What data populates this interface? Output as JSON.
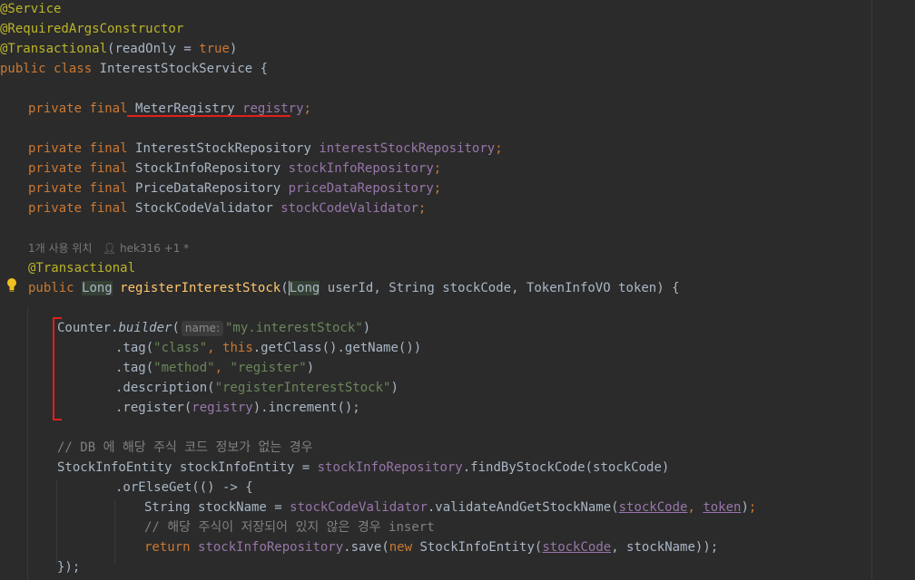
{
  "editor": {
    "lines": {
      "service": "@Service",
      "required_args": "@RequiredArgsConstructor",
      "transactional_ann": "@Transactional",
      "read_only": "readOnly",
      "equals": " = ",
      "true": "true",
      "public": "public",
      "class": "class",
      "class_name": "InterestStockService",
      "private": "private",
      "final": "final",
      "meter_type": "MeterRegistry",
      "meter_field": "registry",
      "repo_type": "InterestStockRepository",
      "repo_field": "interestStockRepository",
      "stockinfo_type": "StockInfoRepository",
      "stockinfo_field": "stockInfoRepository",
      "price_type": "PriceDataRepository",
      "price_field": "priceDataRepository",
      "validator_type": "StockCodeValidator",
      "validator_field": "stockCodeValidator",
      "usage_hint": "1개 사용 위치",
      "author_hint": "hek316 +1 *",
      "method_ann": "@Transactional",
      "long": "Long",
      "method_name": "registerInterestStock",
      "user_id": " userId, ",
      "string": "String",
      "stock_code_param": " stockCode, ",
      "token_type": "TokenInfoVO",
      "token_param": " token) {",
      "counter": "Counter",
      "builder": "builder",
      "name_hint": "name:",
      "counter_name": "\"my.interestStock\"",
      "tag": ".tag(",
      "class_str": "\"class\"",
      "this": "this",
      "get_class": ".getClass().getName())",
      "method_str": "\"method\"",
      "register_str": "\"register\"",
      "description": ".description(",
      "desc_str": "\"registerInterestStock\"",
      "register_call": ".register(",
      "increment": ").increment();",
      "comment1": "// DB 에 해당 주식 코드 정보가 없는 경우",
      "entity_type": "StockInfoEntity",
      "entity_var": " stockInfoEntity = ",
      "find_call": ".findByStockCode(stockCode)",
      "or_else": ".orElseGet(() -> {",
      "stock_name_decl": " stockName = ",
      "validate_call": ".validateAndGetStockName(",
      "stock_code": "stockCode",
      "token": "token",
      "comment2": "// 해당 주식이 저장되어 있지 않은 경우 insert",
      "return": "return",
      "save_call": ".save(",
      "new": "new",
      "entity_ctor": " StockInfoEntity(",
      "stock_name": ", stockName));",
      "close": "});"
    }
  }
}
